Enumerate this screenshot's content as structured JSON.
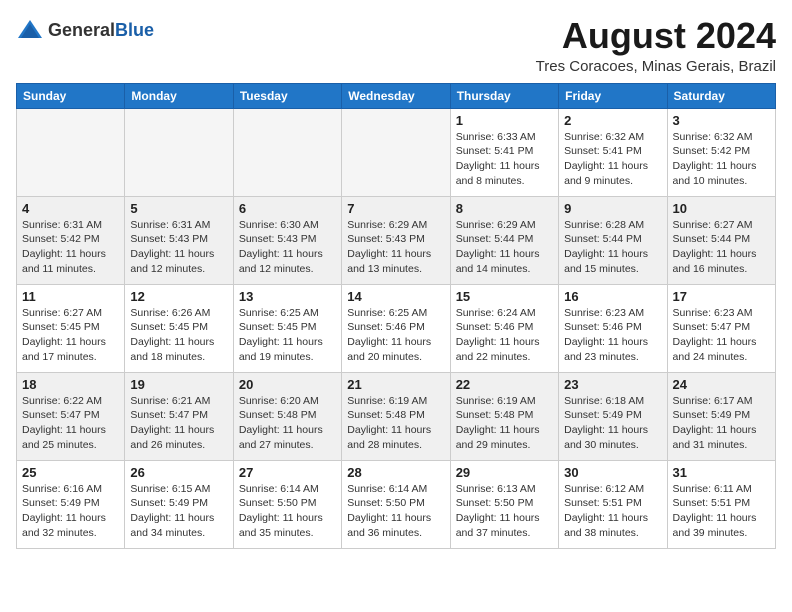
{
  "header": {
    "logo_general": "General",
    "logo_blue": "Blue",
    "title": "August 2024",
    "location": "Tres Coracoes, Minas Gerais, Brazil"
  },
  "days_of_week": [
    "Sunday",
    "Monday",
    "Tuesday",
    "Wednesday",
    "Thursday",
    "Friday",
    "Saturday"
  ],
  "weeks": [
    [
      {
        "day": "",
        "empty": true
      },
      {
        "day": "",
        "empty": true
      },
      {
        "day": "",
        "empty": true
      },
      {
        "day": "",
        "empty": true
      },
      {
        "day": "1",
        "sunrise": "6:33 AM",
        "sunset": "5:41 PM",
        "daylight": "11 hours and 8 minutes."
      },
      {
        "day": "2",
        "sunrise": "6:32 AM",
        "sunset": "5:41 PM",
        "daylight": "11 hours and 9 minutes."
      },
      {
        "day": "3",
        "sunrise": "6:32 AM",
        "sunset": "5:42 PM",
        "daylight": "11 hours and 10 minutes."
      }
    ],
    [
      {
        "day": "4",
        "sunrise": "6:31 AM",
        "sunset": "5:42 PM",
        "daylight": "11 hours and 11 minutes."
      },
      {
        "day": "5",
        "sunrise": "6:31 AM",
        "sunset": "5:43 PM",
        "daylight": "11 hours and 12 minutes."
      },
      {
        "day": "6",
        "sunrise": "6:30 AM",
        "sunset": "5:43 PM",
        "daylight": "11 hours and 12 minutes."
      },
      {
        "day": "7",
        "sunrise": "6:29 AM",
        "sunset": "5:43 PM",
        "daylight": "11 hours and 13 minutes."
      },
      {
        "day": "8",
        "sunrise": "6:29 AM",
        "sunset": "5:44 PM",
        "daylight": "11 hours and 14 minutes."
      },
      {
        "day": "9",
        "sunrise": "6:28 AM",
        "sunset": "5:44 PM",
        "daylight": "11 hours and 15 minutes."
      },
      {
        "day": "10",
        "sunrise": "6:27 AM",
        "sunset": "5:44 PM",
        "daylight": "11 hours and 16 minutes."
      }
    ],
    [
      {
        "day": "11",
        "sunrise": "6:27 AM",
        "sunset": "5:45 PM",
        "daylight": "11 hours and 17 minutes."
      },
      {
        "day": "12",
        "sunrise": "6:26 AM",
        "sunset": "5:45 PM",
        "daylight": "11 hours and 18 minutes."
      },
      {
        "day": "13",
        "sunrise": "6:25 AM",
        "sunset": "5:45 PM",
        "daylight": "11 hours and 19 minutes."
      },
      {
        "day": "14",
        "sunrise": "6:25 AM",
        "sunset": "5:46 PM",
        "daylight": "11 hours and 20 minutes."
      },
      {
        "day": "15",
        "sunrise": "6:24 AM",
        "sunset": "5:46 PM",
        "daylight": "11 hours and 22 minutes."
      },
      {
        "day": "16",
        "sunrise": "6:23 AM",
        "sunset": "5:46 PM",
        "daylight": "11 hours and 23 minutes."
      },
      {
        "day": "17",
        "sunrise": "6:23 AM",
        "sunset": "5:47 PM",
        "daylight": "11 hours and 24 minutes."
      }
    ],
    [
      {
        "day": "18",
        "sunrise": "6:22 AM",
        "sunset": "5:47 PM",
        "daylight": "11 hours and 25 minutes."
      },
      {
        "day": "19",
        "sunrise": "6:21 AM",
        "sunset": "5:47 PM",
        "daylight": "11 hours and 26 minutes."
      },
      {
        "day": "20",
        "sunrise": "6:20 AM",
        "sunset": "5:48 PM",
        "daylight": "11 hours and 27 minutes."
      },
      {
        "day": "21",
        "sunrise": "6:19 AM",
        "sunset": "5:48 PM",
        "daylight": "11 hours and 28 minutes."
      },
      {
        "day": "22",
        "sunrise": "6:19 AM",
        "sunset": "5:48 PM",
        "daylight": "11 hours and 29 minutes."
      },
      {
        "day": "23",
        "sunrise": "6:18 AM",
        "sunset": "5:49 PM",
        "daylight": "11 hours and 30 minutes."
      },
      {
        "day": "24",
        "sunrise": "6:17 AM",
        "sunset": "5:49 PM",
        "daylight": "11 hours and 31 minutes."
      }
    ],
    [
      {
        "day": "25",
        "sunrise": "6:16 AM",
        "sunset": "5:49 PM",
        "daylight": "11 hours and 32 minutes."
      },
      {
        "day": "26",
        "sunrise": "6:15 AM",
        "sunset": "5:49 PM",
        "daylight": "11 hours and 34 minutes."
      },
      {
        "day": "27",
        "sunrise": "6:14 AM",
        "sunset": "5:50 PM",
        "daylight": "11 hours and 35 minutes."
      },
      {
        "day": "28",
        "sunrise": "6:14 AM",
        "sunset": "5:50 PM",
        "daylight": "11 hours and 36 minutes."
      },
      {
        "day": "29",
        "sunrise": "6:13 AM",
        "sunset": "5:50 PM",
        "daylight": "11 hours and 37 minutes."
      },
      {
        "day": "30",
        "sunrise": "6:12 AM",
        "sunset": "5:51 PM",
        "daylight": "11 hours and 38 minutes."
      },
      {
        "day": "31",
        "sunrise": "6:11 AM",
        "sunset": "5:51 PM",
        "daylight": "11 hours and 39 minutes."
      }
    ]
  ]
}
